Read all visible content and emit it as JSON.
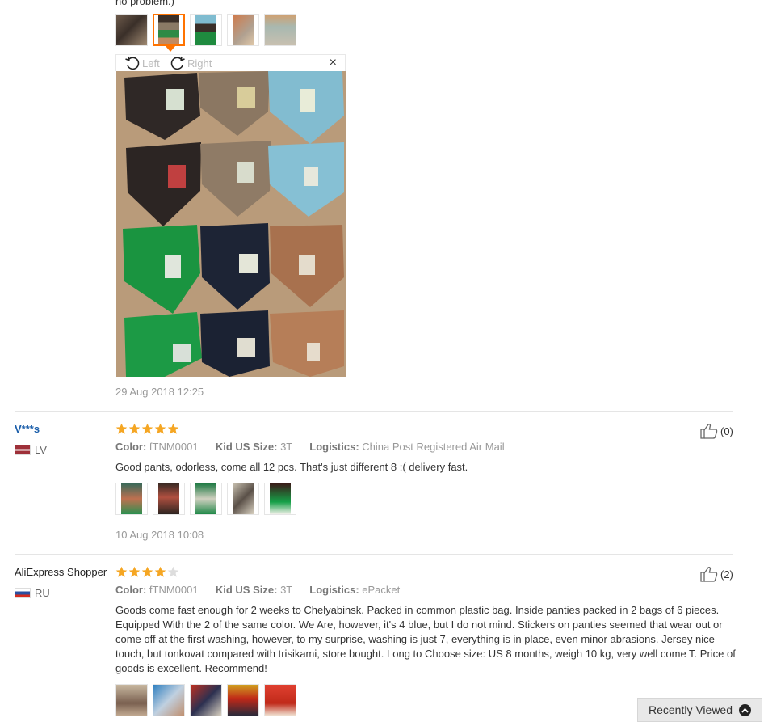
{
  "top_text": "no problem.)",
  "viewer": {
    "rotate_left": "Left",
    "rotate_right": "Right",
    "close_symbol": "×"
  },
  "reviews": [
    {
      "date": "29 Aug 2018 12:25"
    },
    {
      "user": "V***s",
      "country": "LV",
      "rating": 5,
      "color_label": "Color:",
      "color": "fTNM0001",
      "size_label": "Kid US Size:",
      "size": "3T",
      "logistics_label": "Logistics:",
      "logistics": "China Post Registered Air Mail",
      "text": "Good pants, odorless, come all 12 pcs. That's just different 8 :( delivery fast.",
      "helpful_count": "(0)",
      "date": "10 Aug 2018 10:08"
    },
    {
      "user": "AliExpress Shopper",
      "country": "RU",
      "rating": 4,
      "color_label": "Color:",
      "color": "fTNM0001",
      "size_label": "Kid US Size:",
      "size": "3T",
      "logistics_label": "Logistics:",
      "logistics": "ePacket",
      "text": "Goods come fast enough for 2 weeks to Chelyabinsk. Packed in common plastic bag. Inside panties packed in 2 bags of 6 pieces. Equipped With the 2 of the same color. We Are, however, it's 4 blue, but I do not mind. Stickers on panties seemed that wear out or come off at the first washing, however, to my surprise, washing is just 7, everything is in place, even minor abrasions. Jersey nice touch, but tonkovat compared with trisikami, store bought. Long to Choose size: US 8 months, weigh 10 kg, very well come T. Price of goods is excellent. Recommend!",
      "helpful_count": "(2)"
    }
  ],
  "recently_viewed": "Recently Viewed",
  "colors": {
    "accent": "#ff7300",
    "star": "#f5a623",
    "star_empty": "#dddddd",
    "link": "#1b5eaa"
  }
}
